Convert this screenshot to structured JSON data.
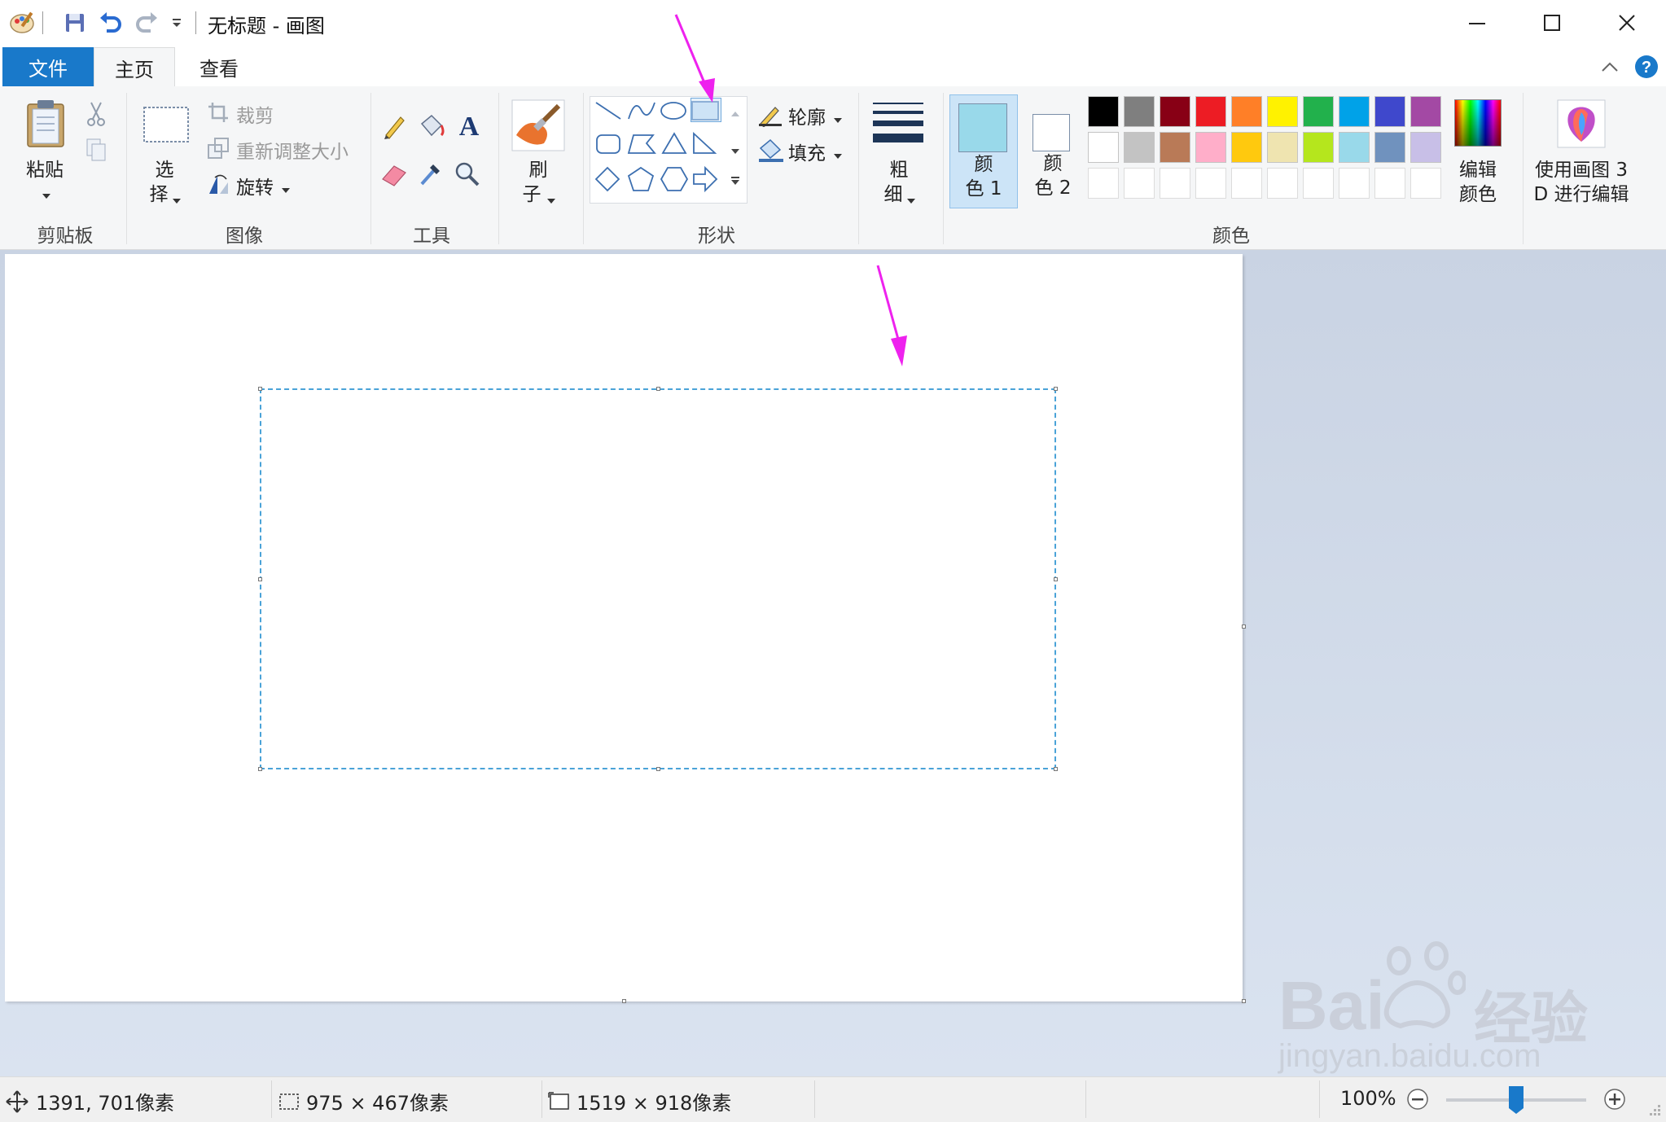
{
  "window": {
    "title": "无标题 - 画图",
    "minimize_icon": "minimize-icon",
    "maximize_icon": "maximize-icon",
    "close_icon": "close-icon"
  },
  "quick_access": [
    "paint-app-icon",
    "save-icon",
    "undo-icon",
    "redo-icon",
    "customize-dropdown-icon"
  ],
  "tabs": [
    {
      "label": "文件",
      "active": false
    },
    {
      "label": "主页",
      "active": true
    },
    {
      "label": "查看",
      "active": false
    }
  ],
  "ribbon": {
    "clipboard": {
      "paste": "粘贴",
      "group": "剪贴板"
    },
    "image": {
      "select_1": "选",
      "select_2": "择",
      "crop": "裁剪",
      "resize": "重新调整大小",
      "rotate": "旋转",
      "group": "图像"
    },
    "tools": {
      "group": "工具"
    },
    "brushes": {
      "label_1": "刷",
      "label_2": "子"
    },
    "shapes": {
      "outline": "轮廓",
      "fill": "填充",
      "group": "形状"
    },
    "size": {
      "label_1": "粗",
      "label_2": "细"
    },
    "colors": {
      "color1_a": "颜",
      "color1_b": "色 1",
      "color2_a": "颜",
      "color2_b": "色 2",
      "color1_value": "#99d9ea",
      "color2_value": "#ffffff",
      "palette_row1": [
        "#000000",
        "#7f7f7f",
        "#880015",
        "#ed1c24",
        "#ff7f27",
        "#fff200",
        "#22b14c",
        "#00a2e8",
        "#3f48cc",
        "#a349a4"
      ],
      "palette_row2": [
        "#ffffff",
        "#c3c3c3",
        "#b97a57",
        "#ffaec9",
        "#ffc90e",
        "#efe4b0",
        "#b5e61d",
        "#99d9ea",
        "#7092be",
        "#c8bfe7"
      ],
      "edit_1": "编辑",
      "edit_2": "颜色",
      "group": "颜色"
    },
    "paint3d": {
      "label_1": "使用画图 3",
      "label_2": "D 进行编辑"
    }
  },
  "status": {
    "cursor": "1391, 701像素",
    "selection": "975 × 467像素",
    "canvas": "1519 × 918像素",
    "zoom": "100%",
    "zoom_level": 0.5
  },
  "annotation_color": "#ee22ee",
  "watermark": {
    "main": "Bai",
    "after": "经验",
    "url": "jingyan.baidu.com"
  }
}
